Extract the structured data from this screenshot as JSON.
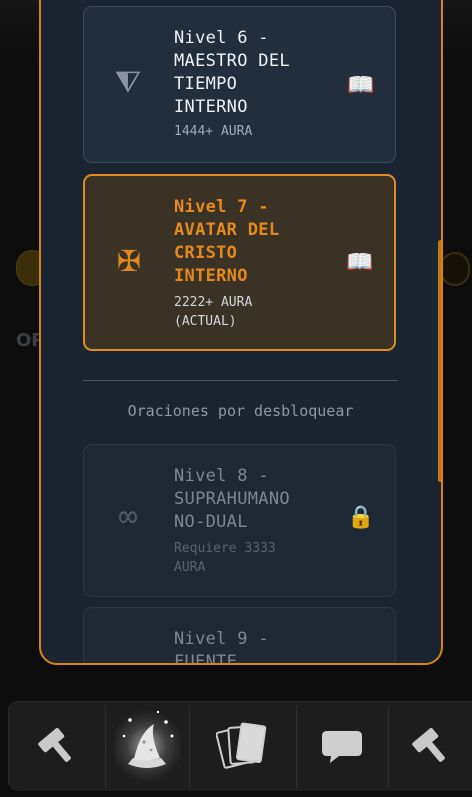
{
  "levels": [
    {
      "title_lines": [
        "Nivel 6 -",
        "MAESTRO DEL",
        "TIEMPO",
        "INTERNO"
      ],
      "aura": "1444+ AURA",
      "symbol": "⧨",
      "symbol_icon": "hourglass-triangle-icon",
      "action_icon": "open-book-icon",
      "state": "unlocked"
    },
    {
      "title_lines": [
        "Nivel 7 -",
        "AVATAR DEL",
        "CRISTO",
        "INTERNO"
      ],
      "aura_lines": [
        "2222+ AURA",
        "(ACTUAL)"
      ],
      "symbol": "✠",
      "symbol_icon": "maltese-cross-icon",
      "action_icon": "open-book-icon",
      "state": "current",
      "accent": "#e08a1f"
    },
    {
      "title_lines": [
        "Nivel 8 -",
        "SUPRAHUMANO",
        "NO-DUAL"
      ],
      "aura_lines": [
        "Requiere 3333",
        "AURA"
      ],
      "symbol": "∞",
      "symbol_icon": "infinity-icon",
      "action_icon": "lock-icon",
      "state": "locked"
    },
    {
      "title_lines": [
        "Nivel 9 -",
        "FUENTE"
      ],
      "state": "locked"
    }
  ],
  "section_label": "Oraciones por desbloquear",
  "book_glyph": "📖",
  "lock_glyph": "🔒",
  "background": {
    "partial_text": "OP"
  },
  "nav": {
    "items": [
      {
        "icon": "hammer-icon",
        "active": false
      },
      {
        "icon": "wizard-hat-icon",
        "active": true
      },
      {
        "icon": "cards-icon",
        "active": false
      },
      {
        "icon": "chat-bubble-icon",
        "active": false
      },
      {
        "icon": "hammer-icon",
        "active": false
      }
    ]
  },
  "colors": {
    "accent": "#e08a1f",
    "panel": "#1b2431",
    "card": "#232e3c",
    "current_card": "#3b3226"
  }
}
